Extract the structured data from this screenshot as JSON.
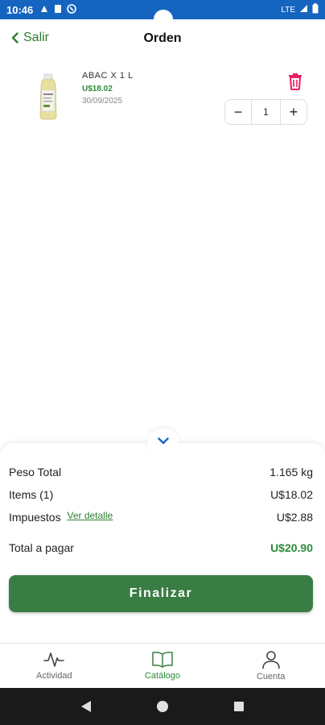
{
  "status_bar": {
    "time": "10:46",
    "network": "LTE",
    "colors": {
      "background": "#1565c0"
    }
  },
  "header": {
    "back_label": "Salir",
    "title": "Orden"
  },
  "order_item": {
    "name": "ABAC X 1 L",
    "price": "U$18.02",
    "date": "30/09/2025",
    "quantity": "1",
    "decrement_label": "−",
    "increment_label": "+"
  },
  "summary": {
    "weight_label": "Peso Total",
    "weight_value": "1.165 kg",
    "items_label": "Items (1)",
    "items_value": "U$18.02",
    "tax_label": "Impuestos",
    "tax_link": "Ver detalle",
    "tax_value": "U$2.88",
    "total_label": "Total a pagar",
    "total_value": "U$20.90",
    "finalize_label": "Finalizar"
  },
  "bottom_nav": {
    "items": [
      {
        "label": "Actividad",
        "icon": "activity-icon"
      },
      {
        "label": "Catálogo",
        "icon": "book-icon",
        "active": true
      },
      {
        "label": "Cuenta",
        "icon": "user-icon"
      }
    ]
  },
  "colors": {
    "accent_green": "#2e7d32",
    "button_green": "#3a7d44",
    "price_green": "#2e8b3a",
    "delete_red": "#e91e63"
  }
}
